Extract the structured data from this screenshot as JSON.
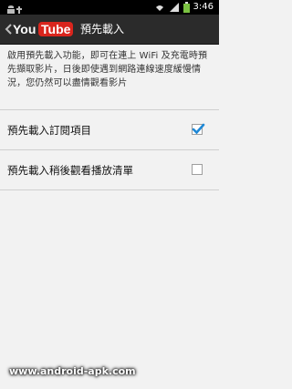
{
  "status_bar": {
    "time": "3:46",
    "icons": [
      "android-icon",
      "usb-icon",
      "wifi-icon",
      "signal-icon",
      "battery-icon"
    ]
  },
  "action_bar": {
    "logo_text": {
      "you": "You",
      "tube": "Tube"
    },
    "title": "預先載入"
  },
  "settings": {
    "description": "啟用預先載入功能，即可在連上 WiFi 及充電時預先擷取影片，日後即使遇到網路連線速度緩慢情況，您仍然可以盡情觀看影片",
    "rows": [
      {
        "label": "預先載入訂閱項目",
        "checked": true
      },
      {
        "label": "預先載入稍後觀看播放清單",
        "checked": false
      }
    ]
  },
  "watermark": "www.android-apk.com",
  "colors": {
    "accent_blue": "#1e88d6",
    "youtube_red": "#d9251d",
    "actionbar_bg": "#2b2b2b",
    "page_bg": "#f2f2f2"
  }
}
